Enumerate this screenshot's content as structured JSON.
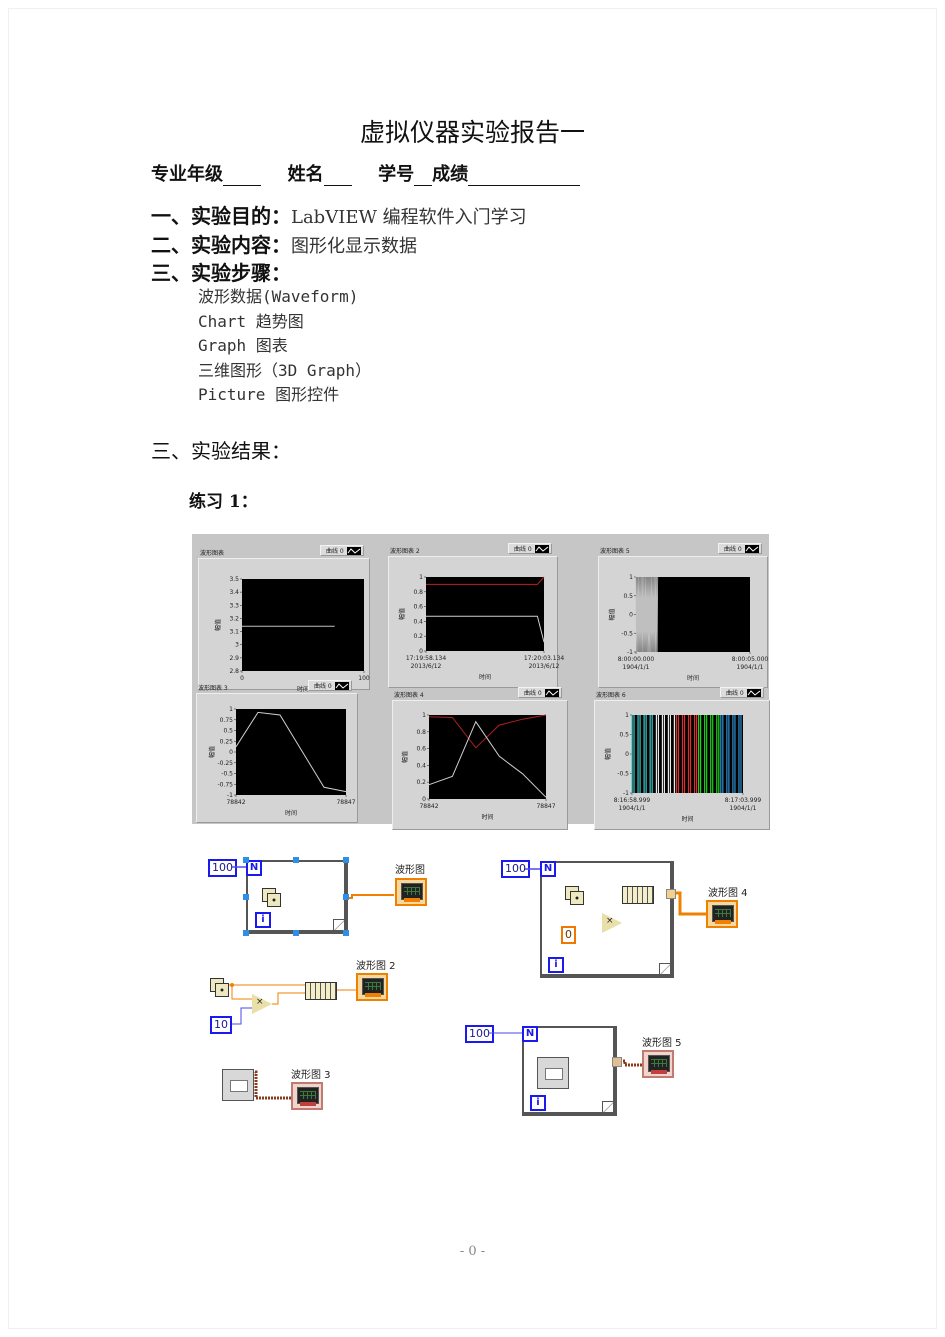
{
  "document": {
    "title": "虚拟仪器实验报告一",
    "info_line": {
      "major_label": "专业年级",
      "name_label": "姓名",
      "id_label": "学号",
      "grade_label": "成绩"
    },
    "sections": [
      {
        "number": "一、",
        "label": "实验目的：",
        "value": "LabVIEW 编程软件入门学习"
      },
      {
        "number": "二、",
        "label": "实验内容：",
        "value": "图形化显示数据"
      },
      {
        "number": "三、",
        "label": "实验步骤：",
        "value": ""
      }
    ],
    "steps": [
      "波形数据(Waveform)",
      "Chart 趋势图",
      "Graph 图表",
      "三维图形（3D Graph）",
      "Picture 图形控件"
    ],
    "results_heading": {
      "number": "三、",
      "label": "实验结果："
    },
    "exercise_label": "练习 1：",
    "page_number": "- 0 -"
  },
  "front_panel": {
    "legend_label": "曲线 0",
    "y_axis_label": "幅值",
    "x_axis_label": "时间"
  },
  "chart_data": [
    {
      "type": "line",
      "title": "波形图表",
      "xlabel": "时间",
      "ylabel": "幅值",
      "xlim": [
        0,
        100
      ],
      "ylim": [
        2.8,
        3.5
      ],
      "x_ticks": [
        "0",
        "100"
      ],
      "y_ticks": [
        "3.5",
        "3.4",
        "3.3",
        "3.2",
        "3.1",
        "3",
        "2.9",
        "2.8"
      ],
      "series": [
        {
          "name": "曲线 0",
          "color": "#bfbfbf",
          "x": [
            0,
            76
          ],
          "y": [
            3.14,
            3.14
          ]
        }
      ]
    },
    {
      "type": "line",
      "title": "波形图表 2",
      "xlabel": "时间",
      "ylabel": "幅值",
      "xlim": [
        0,
        5
      ],
      "ylim": [
        0,
        1
      ],
      "x_ticks": [
        "17:19:58.134\n2013/6/12",
        "17:20:03.134\n2013/6/12"
      ],
      "y_ticks": [
        "1",
        "0.8",
        "0.6",
        "0.4",
        "0.2",
        "0"
      ],
      "series": [
        {
          "name": "red",
          "color": "#c02020",
          "x": [
            0,
            4.72,
            5
          ],
          "y": [
            0.9,
            0.9,
            1.0
          ]
        },
        {
          "name": "white",
          "color": "#cfcfcf",
          "x": [
            0,
            4.72,
            5
          ],
          "y": [
            0.47,
            0.47,
            0.12
          ]
        }
      ]
    },
    {
      "type": "line",
      "title": "波形图表 5",
      "xlabel": "时间",
      "ylabel": "幅值",
      "xlim": [
        0,
        5
      ],
      "ylim": [
        -1,
        1
      ],
      "x_ticks": [
        "8:00:00.000\n1904/1/1",
        "8:00:05.000\n1904/1/1"
      ],
      "y_ticks": [
        "1",
        "0.5",
        "0",
        "-0.5",
        "-1"
      ],
      "noise_band": {
        "x_from": 0,
        "x_to": 0.95,
        "color": "#bfbfbf"
      }
    },
    {
      "type": "line",
      "title": "波形图表 3",
      "xlabel": "时间",
      "ylabel": "幅值",
      "xlim": [
        78842,
        78847
      ],
      "ylim": [
        -1,
        1
      ],
      "x_ticks": [
        "78842",
        "78847"
      ],
      "y_ticks": [
        "1",
        "0.75",
        "0.5",
        "0.25",
        "0",
        "-0.25",
        "-0.5",
        "-0.75",
        "-1"
      ],
      "series": [
        {
          "name": "曲线 0",
          "color": "#cfcfcf",
          "x": [
            78842,
            78843,
            78844,
            78846,
            78847
          ],
          "y": [
            0.12,
            0.92,
            0.86,
            -0.82,
            -0.92
          ]
        }
      ]
    },
    {
      "type": "line",
      "title": "波形图表 4",
      "xlabel": "时间",
      "ylabel": "幅值",
      "xlim": [
        78842,
        78847
      ],
      "ylim": [
        0,
        1
      ],
      "x_ticks": [
        "78842",
        "78847"
      ],
      "y_ticks": [
        "1",
        "0.8",
        "0.6",
        "0.4",
        "0.2",
        "0"
      ],
      "series": [
        {
          "name": "red",
          "color": "#b02020",
          "x": [
            78842,
            78843,
            78844,
            78845,
            78846,
            78847
          ],
          "y": [
            0.98,
            0.97,
            0.61,
            0.88,
            0.95,
            1.0
          ]
        },
        {
          "name": "white",
          "color": "#cfcfcf",
          "x": [
            78842,
            78843,
            78844,
            78845,
            78846,
            78847
          ],
          "y": [
            0.17,
            0.27,
            0.92,
            0.51,
            0.3,
            0.02
          ]
        }
      ]
    },
    {
      "type": "bar",
      "title": "波形图表 6",
      "xlabel": "时间",
      "ylabel": "幅值",
      "xlim": [
        0,
        5
      ],
      "ylim": [
        -1,
        1
      ],
      "x_ticks": [
        "8:16:58.999\n1904/1/1",
        "8:17:03.999\n1904/1/1"
      ],
      "y_ticks": [
        "1",
        "0.5",
        "0",
        "-0.5",
        "-1"
      ],
      "bands": [
        {
          "color": "#40c8c8",
          "from": 0.0,
          "to": 1.0
        },
        {
          "color": "#e8e8e8",
          "from": 1.1,
          "to": 2.0
        },
        {
          "color": "#d83030",
          "from": 2.0,
          "to": 3.0
        },
        {
          "color": "#20d020",
          "from": 3.0,
          "to": 4.0
        },
        {
          "color": "#3090d0",
          "from": 4.0,
          "to": 5.0
        }
      ]
    }
  ],
  "block_diagrams": {
    "const_100": "100",
    "const_10": "10",
    "const_0": "0",
    "n_terminal": "N",
    "i_terminal": "i",
    "graph_labels": [
      "波形图",
      "波形图 2",
      "波形图 3",
      "波形图 4",
      "波形图 5"
    ],
    "multiply_symbol": "×"
  }
}
